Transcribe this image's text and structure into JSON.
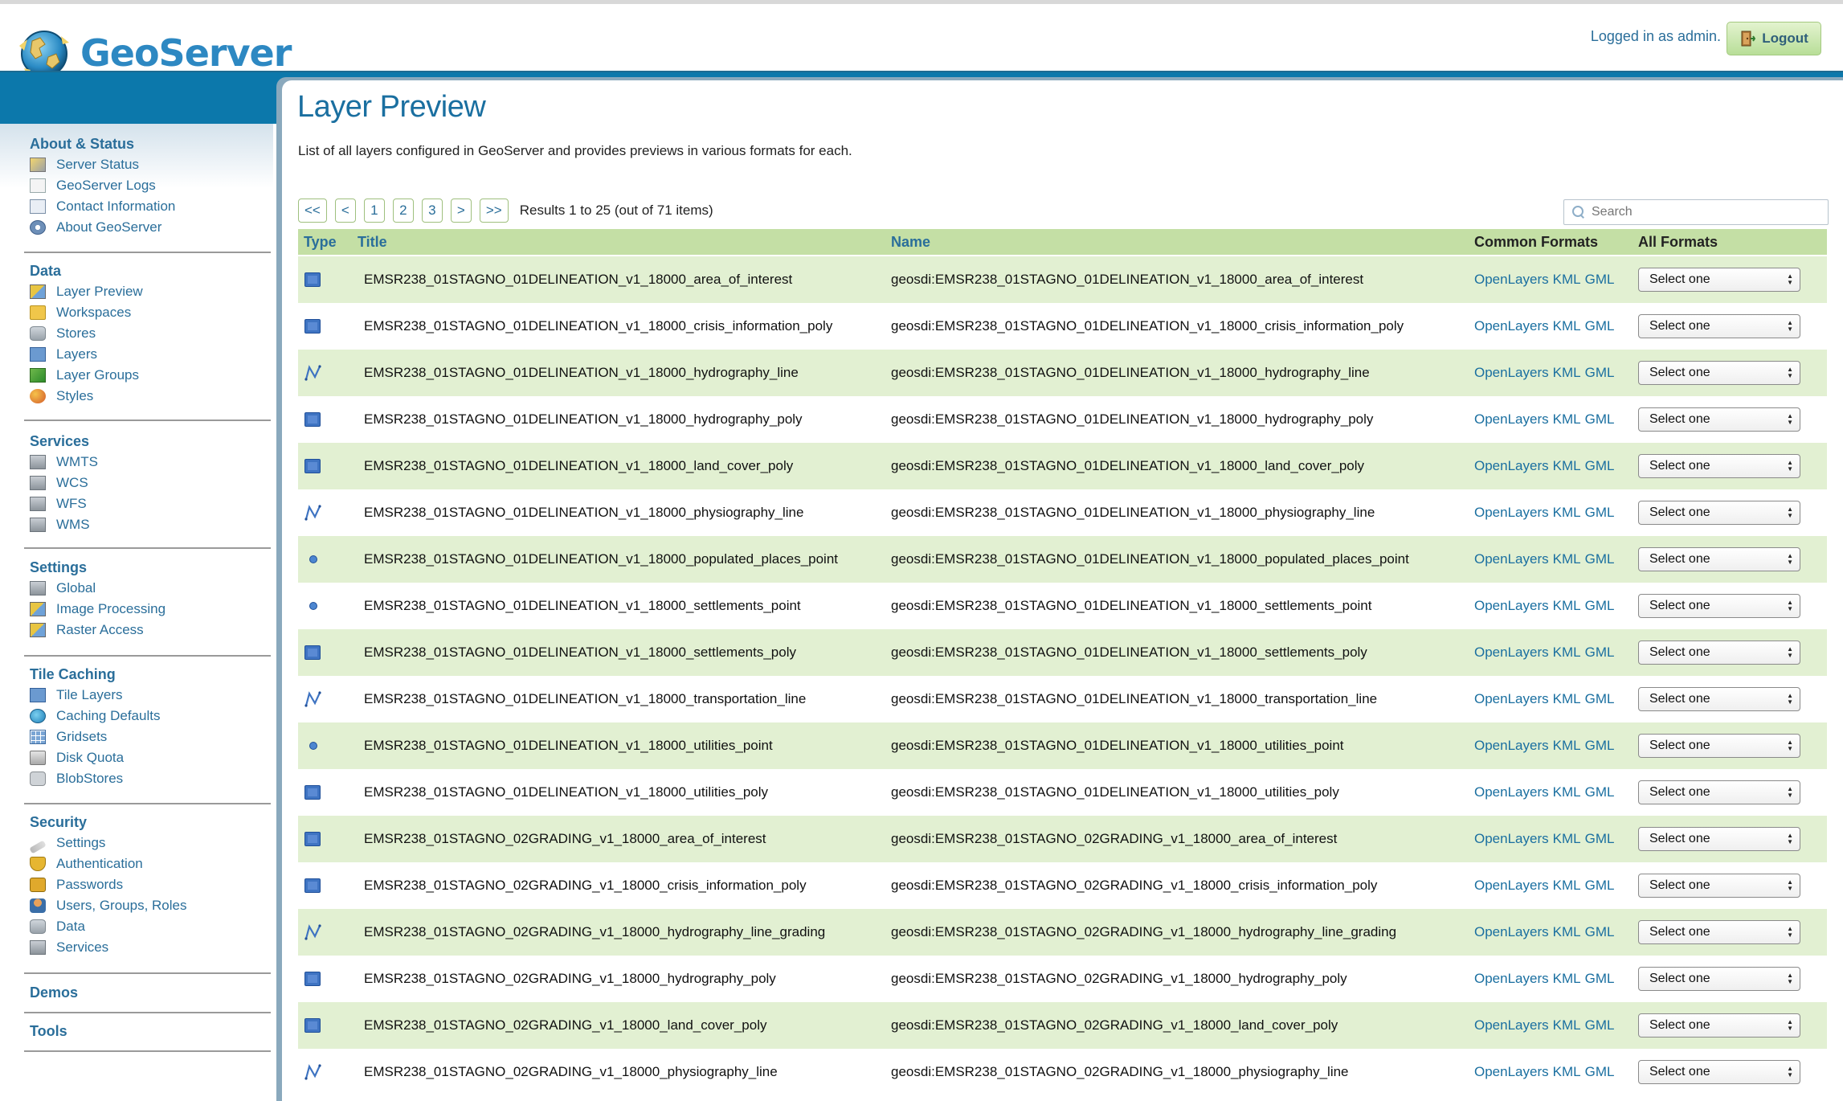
{
  "header": {
    "logo_text": "GeoServer",
    "login_text": "Logged in as admin.",
    "logout_label": "Logout"
  },
  "sidebar": {
    "sections": [
      {
        "heading": "About & Status",
        "items": [
          {
            "label": "Server Status",
            "icon": "server-status-icon"
          },
          {
            "label": "GeoServer Logs",
            "icon": "logs-icon"
          },
          {
            "label": "Contact Information",
            "icon": "contact-card-icon"
          },
          {
            "label": "About GeoServer",
            "icon": "info-icon"
          }
        ]
      },
      {
        "heading": "Data",
        "items": [
          {
            "label": "Layer Preview",
            "icon": "layer-preview-icon"
          },
          {
            "label": "Workspaces",
            "icon": "folder-icon"
          },
          {
            "label": "Stores",
            "icon": "database-icon"
          },
          {
            "label": "Layers",
            "icon": "layer-icon"
          },
          {
            "label": "Layer Groups",
            "icon": "layer-group-icon"
          },
          {
            "label": "Styles",
            "icon": "palette-icon"
          }
        ]
      },
      {
        "heading": "Services",
        "items": [
          {
            "label": "WMTS",
            "icon": "service-icon"
          },
          {
            "label": "WCS",
            "icon": "service-icon"
          },
          {
            "label": "WFS",
            "icon": "service-icon"
          },
          {
            "label": "WMS",
            "icon": "service-icon"
          }
        ]
      },
      {
        "heading": "Settings",
        "items": [
          {
            "label": "Global",
            "icon": "server-icon"
          },
          {
            "label": "Image Processing",
            "icon": "image-icon"
          },
          {
            "label": "Raster Access",
            "icon": "raster-icon"
          }
        ]
      },
      {
        "heading": "Tile Caching",
        "items": [
          {
            "label": "Tile Layers",
            "icon": "tile-layers-icon"
          },
          {
            "label": "Caching Defaults",
            "icon": "globe-icon"
          },
          {
            "label": "Gridsets",
            "icon": "grid-icon"
          },
          {
            "label": "Disk Quota",
            "icon": "disk-icon"
          },
          {
            "label": "BlobStores",
            "icon": "blobstore-icon"
          }
        ]
      },
      {
        "heading": "Security",
        "items": [
          {
            "label": "Settings",
            "icon": "key-icon"
          },
          {
            "label": "Authentication",
            "icon": "shield-icon"
          },
          {
            "label": "Passwords",
            "icon": "lock-icon"
          },
          {
            "label": "Users, Groups, Roles",
            "icon": "users-icon"
          },
          {
            "label": "Data",
            "icon": "database-icon"
          },
          {
            "label": "Services",
            "icon": "service-icon"
          }
        ]
      },
      {
        "heading": "Demos",
        "items": []
      },
      {
        "heading": "Tools",
        "items": []
      }
    ]
  },
  "main": {
    "title": "Layer Preview",
    "description": "List of all layers configured in GeoServer and provides previews in various formats for each.",
    "pager": {
      "first": "<<",
      "prev": "<",
      "pages": [
        "1",
        "2",
        "3"
      ],
      "next": ">",
      "last": ">>",
      "results": "Results 1 to 25 (out of 71 items)"
    },
    "search": {
      "placeholder": "Search",
      "value": ""
    },
    "columns": {
      "type": "Type",
      "title": "Title",
      "name": "Name",
      "common": "Common Formats",
      "all": "All Formats"
    },
    "formats": [
      "OpenLayers",
      "KML",
      "GML"
    ],
    "select_label": "Select one",
    "rows": [
      {
        "type": "polygon",
        "title": "EMSR238_01STAGNO_01DELINEATION_v1_18000_area_of_interest",
        "name": "geosdi:EMSR238_01STAGNO_01DELINEATION_v1_18000_area_of_interest"
      },
      {
        "type": "polygon",
        "title": "EMSR238_01STAGNO_01DELINEATION_v1_18000_crisis_information_poly",
        "name": "geosdi:EMSR238_01STAGNO_01DELINEATION_v1_18000_crisis_information_poly"
      },
      {
        "type": "line",
        "title": "EMSR238_01STAGNO_01DELINEATION_v1_18000_hydrography_line",
        "name": "geosdi:EMSR238_01STAGNO_01DELINEATION_v1_18000_hydrography_line"
      },
      {
        "type": "polygon",
        "title": "EMSR238_01STAGNO_01DELINEATION_v1_18000_hydrography_poly",
        "name": "geosdi:EMSR238_01STAGNO_01DELINEATION_v1_18000_hydrography_poly"
      },
      {
        "type": "polygon",
        "title": "EMSR238_01STAGNO_01DELINEATION_v1_18000_land_cover_poly",
        "name": "geosdi:EMSR238_01STAGNO_01DELINEATION_v1_18000_land_cover_poly"
      },
      {
        "type": "line",
        "title": "EMSR238_01STAGNO_01DELINEATION_v1_18000_physiography_line",
        "name": "geosdi:EMSR238_01STAGNO_01DELINEATION_v1_18000_physiography_line"
      },
      {
        "type": "point",
        "title": "EMSR238_01STAGNO_01DELINEATION_v1_18000_populated_places_point",
        "name": "geosdi:EMSR238_01STAGNO_01DELINEATION_v1_18000_populated_places_point"
      },
      {
        "type": "point",
        "title": "EMSR238_01STAGNO_01DELINEATION_v1_18000_settlements_point",
        "name": "geosdi:EMSR238_01STAGNO_01DELINEATION_v1_18000_settlements_point"
      },
      {
        "type": "polygon",
        "title": "EMSR238_01STAGNO_01DELINEATION_v1_18000_settlements_poly",
        "name": "geosdi:EMSR238_01STAGNO_01DELINEATION_v1_18000_settlements_poly"
      },
      {
        "type": "line",
        "title": "EMSR238_01STAGNO_01DELINEATION_v1_18000_transportation_line",
        "name": "geosdi:EMSR238_01STAGNO_01DELINEATION_v1_18000_transportation_line"
      },
      {
        "type": "point",
        "title": "EMSR238_01STAGNO_01DELINEATION_v1_18000_utilities_point",
        "name": "geosdi:EMSR238_01STAGNO_01DELINEATION_v1_18000_utilities_point"
      },
      {
        "type": "polygon",
        "title": "EMSR238_01STAGNO_01DELINEATION_v1_18000_utilities_poly",
        "name": "geosdi:EMSR238_01STAGNO_01DELINEATION_v1_18000_utilities_poly"
      },
      {
        "type": "polygon",
        "title": "EMSR238_01STAGNO_02GRADING_v1_18000_area_of_interest",
        "name": "geosdi:EMSR238_01STAGNO_02GRADING_v1_18000_area_of_interest"
      },
      {
        "type": "polygon",
        "title": "EMSR238_01STAGNO_02GRADING_v1_18000_crisis_information_poly",
        "name": "geosdi:EMSR238_01STAGNO_02GRADING_v1_18000_crisis_information_poly"
      },
      {
        "type": "line",
        "title": "EMSR238_01STAGNO_02GRADING_v1_18000_hydrography_line_grading",
        "name": "geosdi:EMSR238_01STAGNO_02GRADING_v1_18000_hydrography_line_grading"
      },
      {
        "type": "polygon",
        "title": "EMSR238_01STAGNO_02GRADING_v1_18000_hydrography_poly",
        "name": "geosdi:EMSR238_01STAGNO_02GRADING_v1_18000_hydrography_poly"
      },
      {
        "type": "polygon",
        "title": "EMSR238_01STAGNO_02GRADING_v1_18000_land_cover_poly",
        "name": "geosdi:EMSR238_01STAGNO_02GRADING_v1_18000_land_cover_poly"
      },
      {
        "type": "line",
        "title": "EMSR238_01STAGNO_02GRADING_v1_18000_physiography_line",
        "name": "geosdi:EMSR238_01STAGNO_02GRADING_v1_18000_physiography_line"
      }
    ]
  },
  "colors": {
    "brand_blue": "#0c78ab",
    "link_blue": "#2a6e9a",
    "row_green": "#e2f0d2",
    "header_green": "#c4dfa5"
  }
}
